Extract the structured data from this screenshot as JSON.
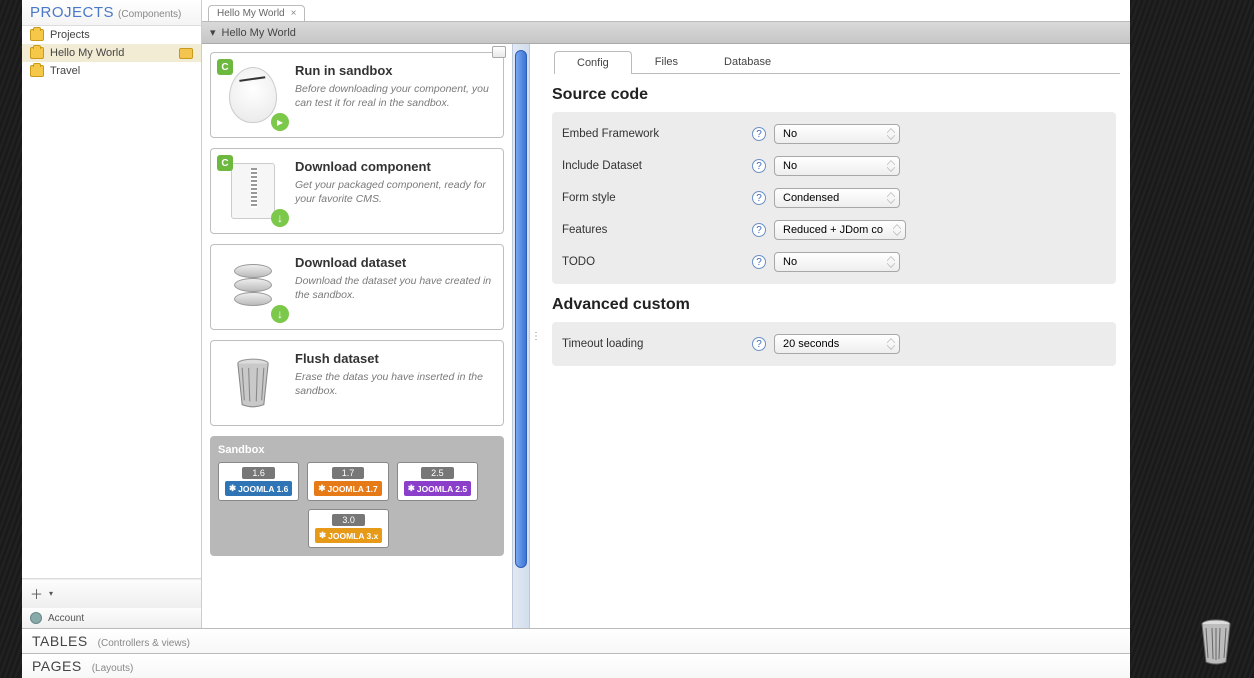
{
  "sidebar": {
    "title": "PROJECTS",
    "subtitle": "(Components)",
    "items": [
      {
        "label": "Projects",
        "selected": false,
        "hasFolderExtra": false
      },
      {
        "label": "Hello My World",
        "selected": true,
        "hasFolderExtra": true
      },
      {
        "label": "Travel",
        "selected": false,
        "hasFolderExtra": false
      }
    ],
    "addLabel": "+",
    "accountLabel": "Account"
  },
  "bottomSections": [
    {
      "title": "TABLES",
      "subtitle": "(Controllers & views)"
    },
    {
      "title": "PAGES",
      "subtitle": "(Layouts)"
    }
  ],
  "docTab": {
    "label": "Hello My World"
  },
  "breadcrumb": {
    "arrow": "▾",
    "label": "Hello My World"
  },
  "actions": [
    {
      "title": "Run in sandbox",
      "desc": "Before downloading your component, you can test it for real in the sandbox.",
      "icon": "egg"
    },
    {
      "title": "Download component",
      "desc": "Get your packaged component, ready for your favorite CMS.",
      "icon": "zip"
    },
    {
      "title": "Download dataset",
      "desc": "Download the dataset you have created in the sandbox.",
      "icon": "db"
    },
    {
      "title": "Flush dataset",
      "desc": "Erase the datas you have inserted in the sandbox.",
      "icon": "trash"
    }
  ],
  "sandbox": {
    "title": "Sandbox",
    "versions": [
      {
        "ver": "1.6",
        "badge": "JOOMLA 1.6",
        "cls": "jb-16"
      },
      {
        "ver": "1.7",
        "badge": "JOOMLA 1.7",
        "cls": "jb-17"
      },
      {
        "ver": "2.5",
        "badge": "JOOMLA 2.5",
        "cls": "jb-25"
      },
      {
        "ver": "3.0",
        "badge": "JOOMLA 3.x",
        "cls": "jb-3x"
      }
    ]
  },
  "config": {
    "tabs": [
      {
        "label": "Config",
        "active": true
      },
      {
        "label": "Files",
        "active": false
      },
      {
        "label": "Database",
        "active": false
      }
    ],
    "sections": [
      {
        "heading": "Source code",
        "rows": [
          {
            "label": "Embed Framework",
            "value": "No"
          },
          {
            "label": "Include Dataset",
            "value": "No"
          },
          {
            "label": "Form style",
            "value": "Condensed"
          },
          {
            "label": "Features",
            "value": "Reduced + JDom co"
          },
          {
            "label": "TODO",
            "value": "No"
          }
        ]
      },
      {
        "heading": "Advanced custom",
        "rows": [
          {
            "label": "Timeout loading",
            "value": "20 seconds"
          }
        ]
      }
    ]
  }
}
